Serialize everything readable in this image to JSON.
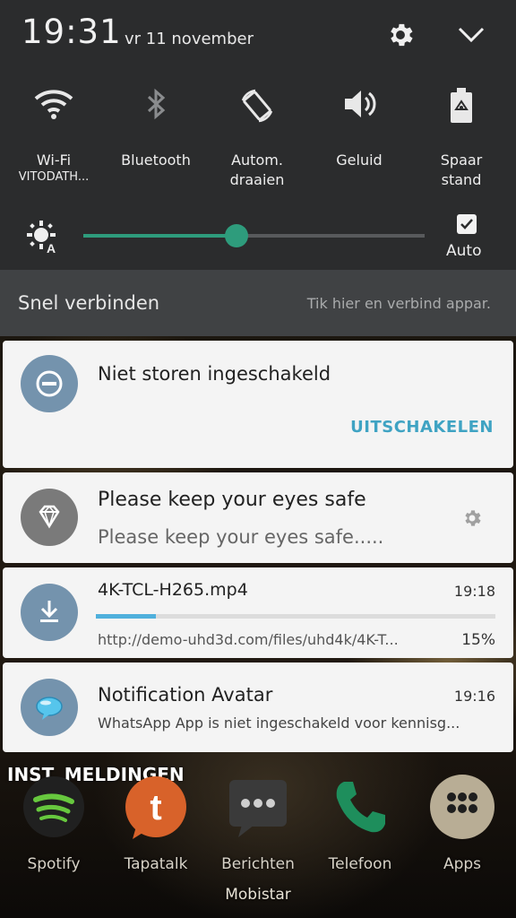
{
  "status": {
    "time": "19:31",
    "date": "vr 11 november"
  },
  "quick_settings": {
    "tiles": [
      {
        "label": "Wi-Fi",
        "sub": "VITODATH...",
        "icon": "wifi-icon"
      },
      {
        "label": "Bluetooth",
        "icon": "bluetooth-icon"
      },
      {
        "label": "Autom.\ndraaien",
        "icon": "auto-rotate-icon"
      },
      {
        "label": "Geluid",
        "icon": "sound-icon"
      },
      {
        "label": "Spaar\nstand",
        "icon": "power-saving-icon"
      }
    ],
    "brightness": {
      "level": 0.45,
      "auto_label": "Auto",
      "auto_checked": true
    },
    "quick_connect": {
      "title": "Snel verbinden",
      "hint": "Tik hier en verbind appar."
    }
  },
  "notifications": [
    {
      "title": "Niet storen ingeschakeld",
      "action": "UITSCHAKELEN",
      "icon": "do-not-disturb-icon"
    },
    {
      "title": "Please keep your eyes safe",
      "body": "Please keep your eyes safe.....",
      "icon": "diamond-icon"
    },
    {
      "title": "4K-TCL-H265.mp4",
      "time": "19:18",
      "body": "http://demo-uhd3d.com/files/uhd4k/4K-T...",
      "progress_label": "15%",
      "progress": 0.15,
      "icon": "download-icon"
    },
    {
      "title": "Notification Avatar",
      "time": "19:16",
      "body": "WhatsApp App is niet ingeschakeld voor kennisg...",
      "icon": "chat-bubble-icon"
    }
  ],
  "notification_settings_label": "INST. MELDINGEN",
  "dock": [
    {
      "label": "Spotify",
      "icon": "spotify-icon"
    },
    {
      "label": "Tapatalk",
      "icon": "tapatalk-icon"
    },
    {
      "label": "Berichten",
      "icon": "messages-icon"
    },
    {
      "label": "Telefoon",
      "icon": "phone-icon"
    },
    {
      "label": "Apps",
      "icon": "apps-icon"
    }
  ],
  "carrier": "Mobistar",
  "colors": {
    "accent": "#2e9c7c",
    "action": "#3fa3c3",
    "progress": "#4fb0dc",
    "avatar": "#7493ad"
  }
}
